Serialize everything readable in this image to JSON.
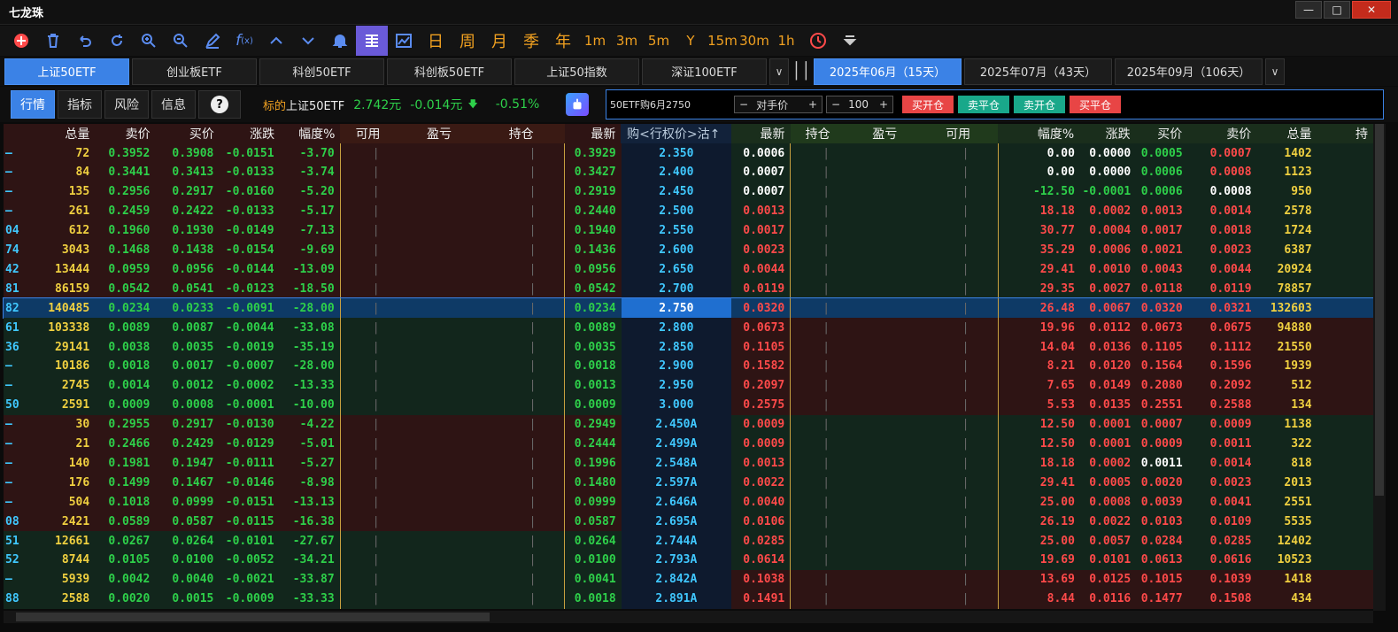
{
  "window": {
    "title": "七龙珠"
  },
  "toolbar": {
    "periods": [
      "日",
      "周",
      "月",
      "季",
      "年"
    ],
    "intervals": [
      "1m",
      "3m",
      "5m",
      "Y",
      "15m",
      "30m",
      "1h"
    ]
  },
  "underlyings": {
    "tabs": [
      "上证50ETF",
      "创业板ETF",
      "科创50ETF",
      "科创板50ETF",
      "上证50指数",
      "深证100ETF"
    ],
    "active": 0
  },
  "months": {
    "tabs": [
      "2025年06月（15天）",
      "2025年07月（43天）",
      "2025年09月（106天）"
    ],
    "active": 0
  },
  "view_tabs": {
    "items": [
      "行情",
      "指标",
      "风险",
      "信息"
    ],
    "active": 0,
    "help_label": "?"
  },
  "underlying_info": {
    "label": "标的",
    "name": "上证50ETF",
    "price": "2.742元",
    "change": "-0.014元",
    "pct": "-0.51%"
  },
  "order": {
    "contract": "50ETF购6月2750",
    "price_type": "对手价",
    "quantity": "100",
    "buttons": [
      {
        "label": "买开仓",
        "color": "#e84545"
      },
      {
        "label": "卖平仓",
        "color": "#19a88a"
      },
      {
        "label": "卖开仓",
        "color": "#19a88a"
      },
      {
        "label": "买平仓",
        "color": "#e84545"
      }
    ]
  },
  "headers": [
    "总量",
    "卖价",
    "买价",
    "涨跌",
    "幅度%",
    "可用",
    "盈亏",
    "持仓",
    "最新",
    "购<行权价>沽↑",
    "最新",
    "持仓",
    "盈亏",
    "可用",
    "幅度%",
    "涨跌",
    "买价",
    "卖价",
    "总量",
    "持"
  ],
  "rows": [
    [
      "—",
      "72",
      "0.3952",
      "0.3908",
      "-0.0151",
      "-3.70",
      "0.3929",
      "2.350",
      "0.0006",
      "0.00",
      "0.0000",
      "0.0005",
      "0.0007",
      "1402"
    ],
    [
      "—",
      "84",
      "0.3441",
      "0.3413",
      "-0.0133",
      "-3.74",
      "0.3427",
      "2.400",
      "0.0007",
      "0.00",
      "0.0000",
      "0.0006",
      "0.0008",
      "1123"
    ],
    [
      "—",
      "135",
      "0.2956",
      "0.2917",
      "-0.0160",
      "-5.20",
      "0.2919",
      "2.450",
      "0.0007",
      "-12.50",
      "-0.0001",
      "0.0006",
      "0.0008",
      "950"
    ],
    [
      "—",
      "261",
      "0.2459",
      "0.2422",
      "-0.0133",
      "-5.17",
      "0.2440",
      "2.500",
      "0.0013",
      "18.18",
      "0.0002",
      "0.0013",
      "0.0014",
      "2578"
    ],
    [
      "04",
      "612",
      "0.1960",
      "0.1930",
      "-0.0149",
      "-7.13",
      "0.1940",
      "2.550",
      "0.0017",
      "30.77",
      "0.0004",
      "0.0017",
      "0.0018",
      "1724"
    ],
    [
      "74",
      "3043",
      "0.1468",
      "0.1438",
      "-0.0154",
      "-9.69",
      "0.1436",
      "2.600",
      "0.0023",
      "35.29",
      "0.0006",
      "0.0021",
      "0.0023",
      "6387"
    ],
    [
      "42",
      "13444",
      "0.0959",
      "0.0956",
      "-0.0144",
      "-13.09",
      "0.0956",
      "2.650",
      "0.0044",
      "29.41",
      "0.0010",
      "0.0043",
      "0.0044",
      "20924"
    ],
    [
      "81",
      "86159",
      "0.0542",
      "0.0541",
      "-0.0123",
      "-18.50",
      "0.0542",
      "2.700",
      "0.0119",
      "29.35",
      "0.0027",
      "0.0118",
      "0.0119",
      "78857"
    ],
    [
      "82",
      "140485",
      "0.0234",
      "0.0233",
      "-0.0091",
      "-28.00",
      "0.0234",
      "2.750",
      "0.0320",
      "26.48",
      "0.0067",
      "0.0320",
      "0.0321",
      "132603"
    ],
    [
      "61",
      "103338",
      "0.0089",
      "0.0087",
      "-0.0044",
      "-33.08",
      "0.0089",
      "2.800",
      "0.0673",
      "19.96",
      "0.0112",
      "0.0673",
      "0.0675",
      "94880"
    ],
    [
      "36",
      "29141",
      "0.0038",
      "0.0035",
      "-0.0019",
      "-35.19",
      "0.0035",
      "2.850",
      "0.1105",
      "14.04",
      "0.0136",
      "0.1105",
      "0.1112",
      "21550"
    ],
    [
      "—",
      "10186",
      "0.0018",
      "0.0017",
      "-0.0007",
      "-28.00",
      "0.0018",
      "2.900",
      "0.1582",
      "8.21",
      "0.0120",
      "0.1564",
      "0.1596",
      "1939"
    ],
    [
      "—",
      "2745",
      "0.0014",
      "0.0012",
      "-0.0002",
      "-13.33",
      "0.0013",
      "2.950",
      "0.2097",
      "7.65",
      "0.0149",
      "0.2080",
      "0.2092",
      "512"
    ],
    [
      "50",
      "2591",
      "0.0009",
      "0.0008",
      "-0.0001",
      "-10.00",
      "0.0009",
      "3.000",
      "0.2575",
      "5.53",
      "0.0135",
      "0.2551",
      "0.2588",
      "134"
    ],
    [
      "—",
      "30",
      "0.2955",
      "0.2917",
      "-0.0130",
      "-4.22",
      "0.2949",
      "2.450A",
      "0.0009",
      "12.50",
      "0.0001",
      "0.0007",
      "0.0009",
      "1138"
    ],
    [
      "—",
      "21",
      "0.2466",
      "0.2429",
      "-0.0129",
      "-5.01",
      "0.2444",
      "2.499A",
      "0.0009",
      "12.50",
      "0.0001",
      "0.0009",
      "0.0011",
      "322"
    ],
    [
      "—",
      "140",
      "0.1981",
      "0.1947",
      "-0.0111",
      "-5.27",
      "0.1996",
      "2.548A",
      "0.0013",
      "18.18",
      "0.0002",
      "0.0011",
      "0.0014",
      "818"
    ],
    [
      "—",
      "176",
      "0.1499",
      "0.1467",
      "-0.0146",
      "-8.98",
      "0.1480",
      "2.597A",
      "0.0022",
      "29.41",
      "0.0005",
      "0.0020",
      "0.0023",
      "2013"
    ],
    [
      "—",
      "504",
      "0.1018",
      "0.0999",
      "-0.0151",
      "-13.13",
      "0.0999",
      "2.646A",
      "0.0040",
      "25.00",
      "0.0008",
      "0.0039",
      "0.0041",
      "2551"
    ],
    [
      "08",
      "2421",
      "0.0589",
      "0.0587",
      "-0.0115",
      "-16.38",
      "0.0587",
      "2.695A",
      "0.0106",
      "26.19",
      "0.0022",
      "0.0103",
      "0.0109",
      "5535"
    ],
    [
      "51",
      "12661",
      "0.0267",
      "0.0264",
      "-0.0101",
      "-27.67",
      "0.0264",
      "2.744A",
      "0.0285",
      "25.00",
      "0.0057",
      "0.0284",
      "0.0285",
      "12402"
    ],
    [
      "52",
      "8744",
      "0.0105",
      "0.0100",
      "-0.0052",
      "-34.21",
      "0.0100",
      "2.793A",
      "0.0614",
      "19.69",
      "0.0101",
      "0.0613",
      "0.0616",
      "10523"
    ],
    [
      "—",
      "5939",
      "0.0042",
      "0.0040",
      "-0.0021",
      "-33.87",
      "0.0041",
      "2.842A",
      "0.1038",
      "13.69",
      "0.0125",
      "0.1015",
      "0.1039",
      "1418"
    ],
    [
      "88",
      "2588",
      "0.0020",
      "0.0015",
      "-0.0009",
      "-33.33",
      "0.0018",
      "2.891A",
      "0.1491",
      "8.44",
      "0.0116",
      "0.1477",
      "0.1508",
      "434"
    ]
  ],
  "colors": {
    "green": "#2ed04a",
    "red": "#ff4a4a",
    "yellow": "#f0d040",
    "cyan": "#40c8ff",
    "white": "#ffffff",
    "accent": "#3b82e6"
  }
}
